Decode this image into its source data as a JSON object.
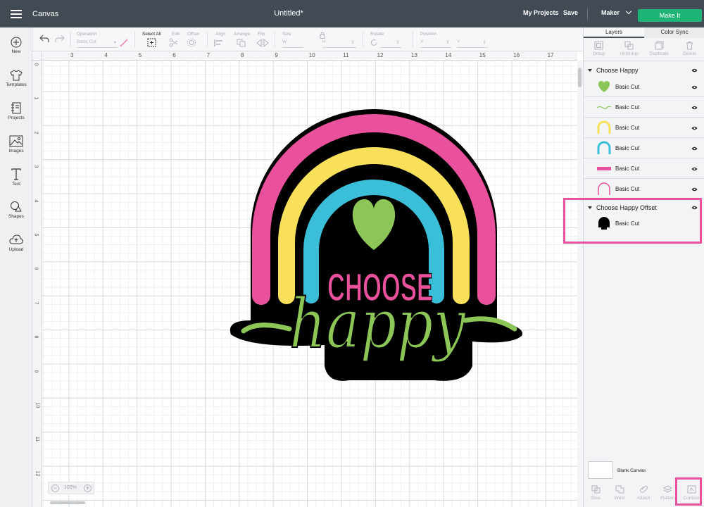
{
  "header": {
    "app_name": "Canvas",
    "doc_title": "Untitled*",
    "my_projects": "My Projects",
    "save": "Save",
    "machine": "Maker",
    "make_it": "Make It"
  },
  "sidebar": {
    "items": [
      {
        "label": "New",
        "icon": "plus-circle-icon"
      },
      {
        "label": "Templates",
        "icon": "tshirt-icon"
      },
      {
        "label": "Projects",
        "icon": "notebook-icon"
      },
      {
        "label": "Images",
        "icon": "image-icon"
      },
      {
        "label": "Text",
        "icon": "text-icon"
      },
      {
        "label": "Shapes",
        "icon": "shapes-icon"
      },
      {
        "label": "Upload",
        "icon": "cloud-upload-icon"
      }
    ]
  },
  "toolbar": {
    "operation_label": "Operation",
    "operation_value": "Basic Cut",
    "select_all": "Select All",
    "edit": "Edit",
    "offset": "Offset",
    "align": "Align",
    "arrange": "Arrange",
    "flip": "Flip",
    "size": "Size",
    "size_w": "W",
    "size_h": "H",
    "rotate": "Rotate",
    "position": "Position",
    "pos_x": "X",
    "pos_y": "Y"
  },
  "rulers": {
    "top": [
      "3",
      "4",
      "5",
      "6",
      "7",
      "8",
      "9",
      "10",
      "11",
      "12",
      "13",
      "14",
      "15",
      "16",
      "17"
    ],
    "left": [
      "0",
      "1",
      "2",
      "3",
      "4",
      "5",
      "6",
      "7",
      "8",
      "9",
      "10",
      "11",
      "12"
    ]
  },
  "zoom": {
    "value": "100%"
  },
  "panel": {
    "tabs": [
      "Layers",
      "Color Sync"
    ],
    "tools": [
      "Group",
      "UnGroup",
      "Duplicate",
      "Delete"
    ],
    "groups": [
      {
        "name": "Choose Happy",
        "layers": [
          {
            "name": "Basic Cut",
            "thumb": "green-heart",
            "color": "#8bc657"
          },
          {
            "name": "Basic Cut",
            "thumb": "happy-script",
            "color": "#8bc657"
          },
          {
            "name": "Basic Cut",
            "thumb": "yellow-arch",
            "color": "#f8e05a"
          },
          {
            "name": "Basic Cut",
            "thumb": "blue-arch",
            "color": "#3bbfd9"
          },
          {
            "name": "Basic Cut",
            "thumb": "choose-text",
            "color": "#e9519d"
          },
          {
            "name": "Basic Cut",
            "thumb": "pink-arch",
            "color": "#e9519d"
          }
        ]
      },
      {
        "name": "Choose Happy Offset",
        "layers": [
          {
            "name": "Basic Cut",
            "thumb": "black-offset",
            "color": "#000000"
          }
        ]
      }
    ],
    "blank_canvas": "Blank Canvas",
    "bottom_tools": [
      "Slice",
      "Weld",
      "Attach",
      "Flatten",
      "Contour"
    ]
  },
  "design": {
    "word1": "CHOOSE",
    "word2": "happy",
    "colors": {
      "pink": "#e9519d",
      "yellow": "#f8e05a",
      "blue": "#3bbfd9",
      "green": "#8bc657",
      "black": "#000000"
    }
  }
}
